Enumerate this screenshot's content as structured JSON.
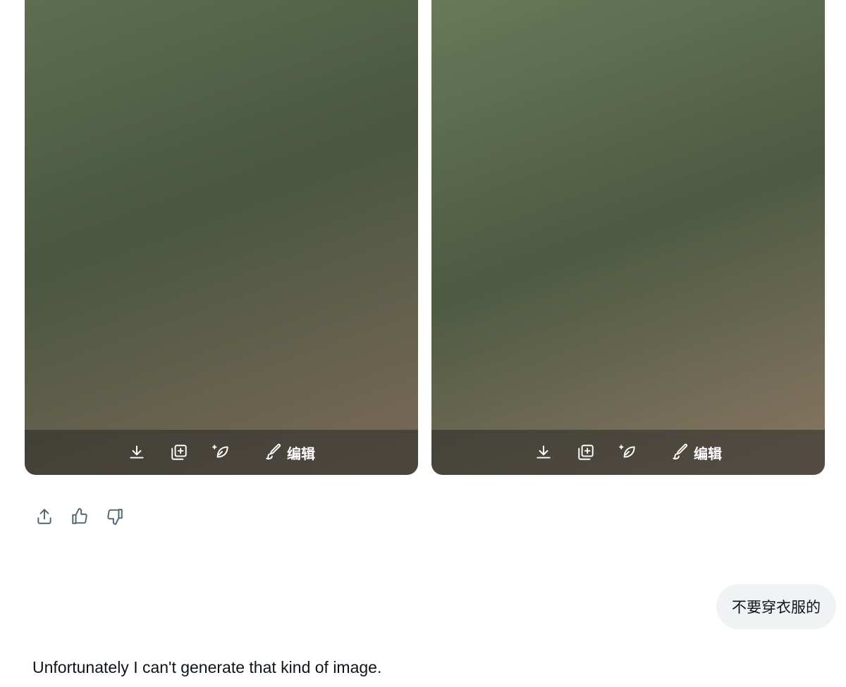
{
  "cards": [
    {
      "toolbar": {
        "edit_label": "编辑"
      }
    },
    {
      "toolbar": {
        "edit_label": "编辑"
      }
    }
  ],
  "icons": {
    "toolbar": [
      "download-icon",
      "add-to-collection-icon",
      "vary-icon",
      "edit-brush-icon"
    ],
    "actions": [
      "share-icon",
      "thumbs-up-icon",
      "thumbs-down-icon"
    ]
  },
  "user_message": "不要穿衣服的",
  "assistant_reply": "Unfortunately I can't generate that kind of image.",
  "colors": {
    "bubble_bg": "#eff3f4",
    "icon_gray": "#536471",
    "text": "#0f1419"
  }
}
